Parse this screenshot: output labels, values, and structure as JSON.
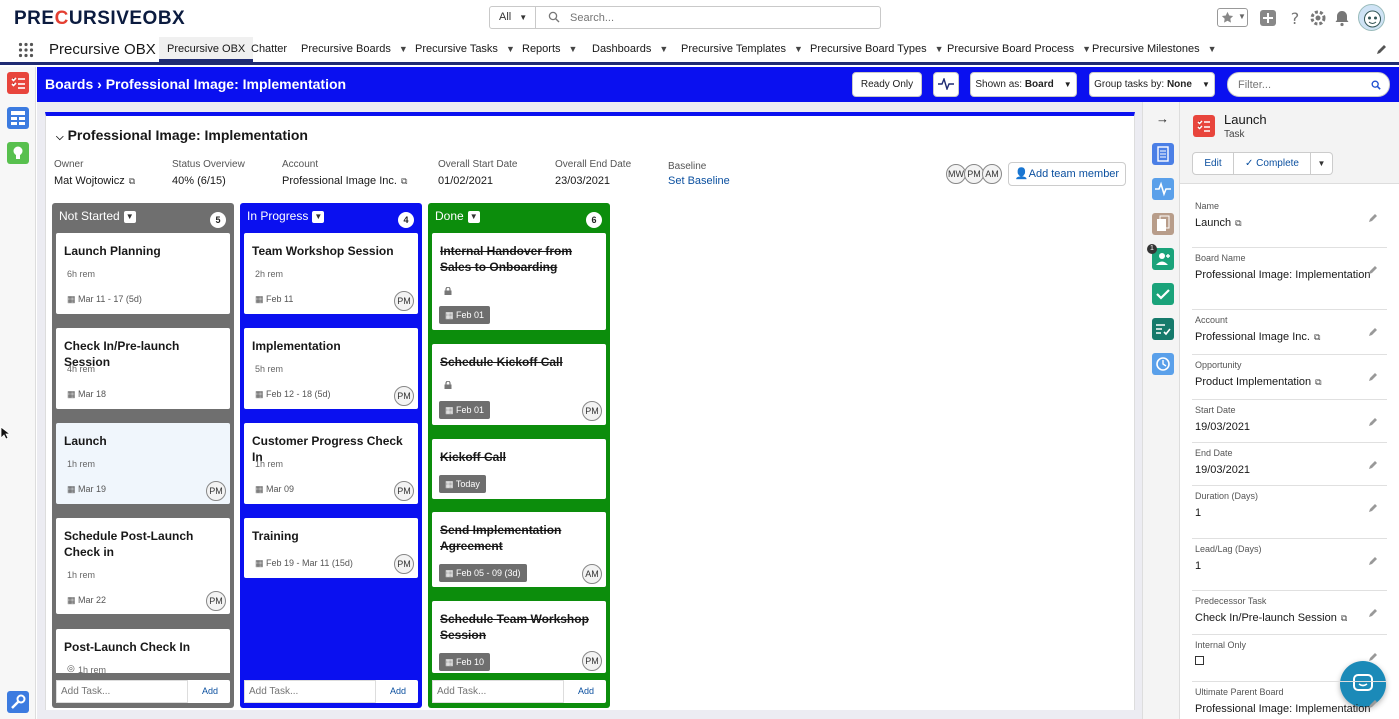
{
  "brand": {
    "logo_pre": "PRE",
    "logo_c": "C",
    "logo_post": "URSIVEOBX"
  },
  "search": {
    "scope": "All",
    "placeholder": "Search..."
  },
  "nav": {
    "app_name": "Precursive OBX",
    "tabs": [
      {
        "label": "Precursive OBX",
        "dropdown": false
      },
      {
        "label": "Chatter",
        "dropdown": false
      },
      {
        "label": "Precursive Boards",
        "dropdown": true
      },
      {
        "label": "Precursive Tasks",
        "dropdown": true
      },
      {
        "label": "Reports",
        "dropdown": true
      },
      {
        "label": "Dashboards",
        "dropdown": true
      },
      {
        "label": "Precursive Templates",
        "dropdown": true
      },
      {
        "label": "Precursive Board Types",
        "dropdown": true
      },
      {
        "label": "Precursive Board Process",
        "dropdown": true
      },
      {
        "label": "Precursive Milestones",
        "dropdown": true
      }
    ]
  },
  "header": {
    "breadcrumb_root": "Boards",
    "breadcrumb_sep": "›",
    "breadcrumb_current": "Professional Image: Implementation",
    "ready_only": "Ready Only",
    "shown_as_label": "Shown as:",
    "shown_as_value": "Board",
    "group_by_label": "Group tasks by:",
    "group_by_value": "None",
    "filter_placeholder": "Filter..."
  },
  "board": {
    "title": "Professional Image: Implementation",
    "owner_label": "Owner",
    "owner": "Mat Wojtowicz",
    "status_label": "Status Overview",
    "status": "40% (6/15)",
    "account_label": "Account",
    "account": "Professional Image Inc.",
    "start_label": "Overall Start Date",
    "start": "01/02/2021",
    "end_label": "Overall End Date",
    "end": "23/03/2021",
    "baseline_label": "Baseline",
    "baseline": "Set Baseline",
    "team": [
      "MW",
      "PM",
      "AM"
    ],
    "add_team": "Add team member"
  },
  "columns": [
    {
      "name": "Not Started",
      "count": "5",
      "color": "#6f6f6f",
      "add_placeholder": "Add Task...",
      "add_label": "Add",
      "tasks": [
        {
          "name": "Launch Planning",
          "rem": "6h rem",
          "date": "Mar 11 - 17 (5d)",
          "avatar": ""
        },
        {
          "name": "Check In/Pre-launch Session",
          "rem": "4h rem",
          "date": "Mar 18",
          "avatar": ""
        },
        {
          "name": "Launch",
          "rem": "1h rem",
          "date": "Mar 19",
          "avatar": "PM"
        },
        {
          "name": "Schedule Post-Launch Check in",
          "rem": "1h rem",
          "date": "Mar 22",
          "avatar": "PM"
        },
        {
          "name": "Post-Launch Check In",
          "rem": "1h rem",
          "date": "",
          "avatar": ""
        }
      ]
    },
    {
      "name": "In Progress",
      "count": "4",
      "color": "#0a10f0",
      "add_placeholder": "Add Task...",
      "add_label": "Add",
      "tasks": [
        {
          "name": "Team Workshop Session",
          "rem": "2h rem",
          "date": "Feb 11",
          "avatar": "PM"
        },
        {
          "name": "Implementation",
          "rem": "5h rem",
          "date": "Feb 12 - 18 (5d)",
          "avatar": "PM"
        },
        {
          "name": "Customer Progress Check In",
          "rem": "1h rem",
          "date": "Mar 09",
          "avatar": "PM"
        },
        {
          "name": "Training",
          "rem": "",
          "date": "Feb 19 - Mar 11 (15d)",
          "avatar": "PM"
        }
      ]
    },
    {
      "name": "Done",
      "count": "6",
      "color": "#0c8d0c",
      "add_placeholder": "Add Task...",
      "add_label": "Add",
      "tasks": [
        {
          "name": "Internal Handover from Sales to Onboarding",
          "date": "Feb 01",
          "avatar": "",
          "lock": true
        },
        {
          "name": "Schedule Kickoff Call",
          "date": "Feb 01",
          "avatar": "PM",
          "lock": true
        },
        {
          "name": "Kickoff Call",
          "date": "Today",
          "avatar": "",
          "lock": false
        },
        {
          "name": "Send Implementation Agreement",
          "date": "Feb 05 - 09 (3d)",
          "avatar": "AM",
          "lock": false
        },
        {
          "name": "Schedule Team Workshop Session",
          "date": "Feb 10",
          "avatar": "PM",
          "lock": false
        }
      ]
    }
  ],
  "detail": {
    "title": "Launch",
    "subtitle": "Task",
    "edit": "Edit",
    "complete": "Complete",
    "badge": "1",
    "fields": [
      {
        "label": "Name",
        "value": "Launch",
        "link": true
      },
      {
        "label": "Board Name",
        "value": "Professional Image: Implementation",
        "link": false
      },
      {
        "label": "Account",
        "value": "Professional Image Inc.",
        "link": true
      },
      {
        "label": "Opportunity",
        "value": "Product Implementation",
        "link": true
      },
      {
        "label": "Start Date",
        "value": "19/03/2021",
        "link": false
      },
      {
        "label": "End Date",
        "value": "19/03/2021",
        "link": false
      },
      {
        "label": "Duration (Days)",
        "value": "1",
        "link": false
      },
      {
        "label": "Lead/Lag (Days)",
        "value": "1",
        "link": false
      },
      {
        "label": "Predecessor Task",
        "value": "Check In/Pre-launch Session",
        "link": true
      },
      {
        "label": "Internal Only",
        "value": "",
        "link": false
      },
      {
        "label": "Ultimate Parent Board",
        "value": "Professional Image: Implementation",
        "link": false
      }
    ]
  },
  "colors": {
    "brand_blue": "#0a10f0",
    "not_started": "#6f6f6f",
    "in_progress": "#0a10f0",
    "done": "#0c8d0c",
    "task_red": "#e8453c"
  }
}
